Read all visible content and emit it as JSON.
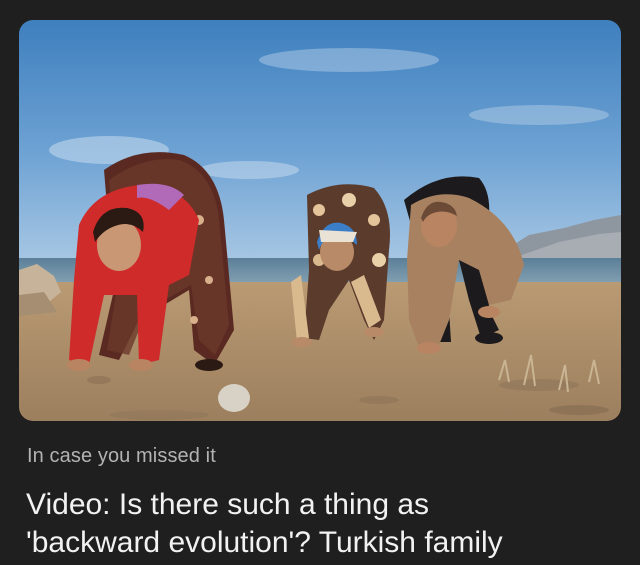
{
  "feed_card": {
    "kicker": "In case you missed it",
    "headline_line1": "Video: Is there such a thing as",
    "headline_line2": "'backward evolution'? Turkish family"
  },
  "colors": {
    "background": "#1f1f1f",
    "kicker_text": "#b3b3b3",
    "headline_text": "#f2f2f2"
  }
}
